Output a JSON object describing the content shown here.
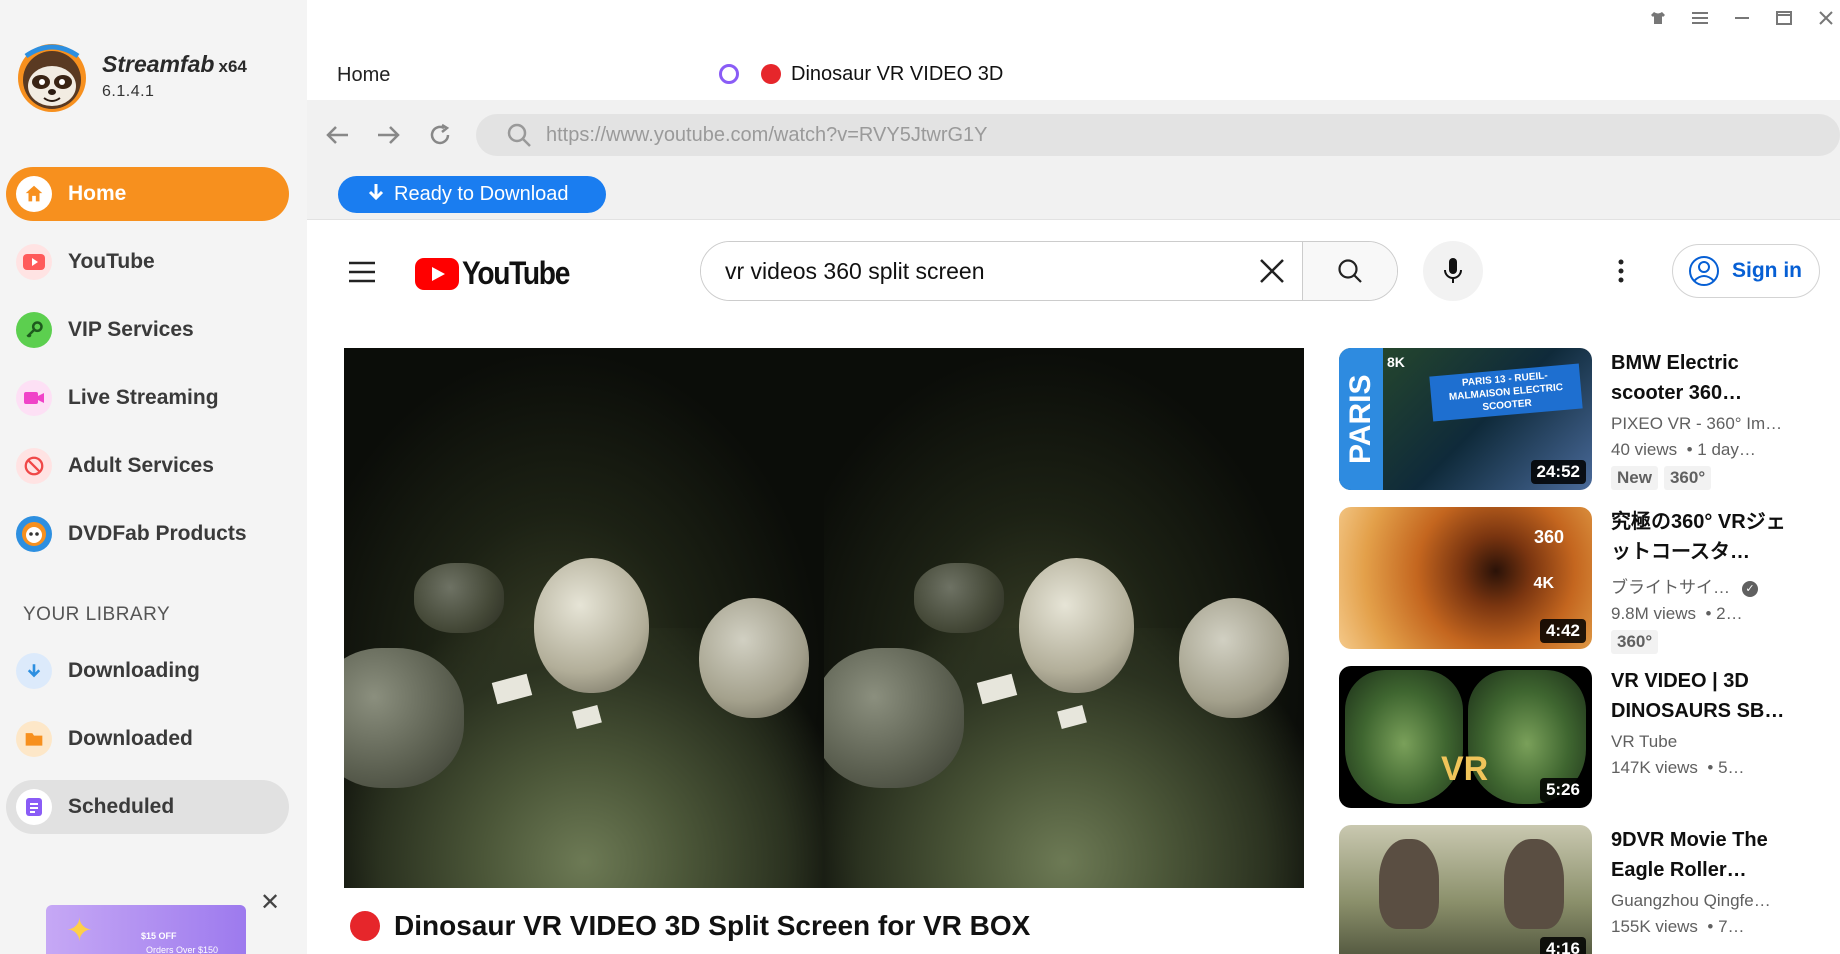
{
  "app": {
    "name": "Streamfab",
    "arch": "x64",
    "version": "6.1.4.1"
  },
  "nav": [
    {
      "label": "Home",
      "icon": "home-icon",
      "color": "#f7901e",
      "active": true
    },
    {
      "label": "YouTube",
      "icon": "youtube-icon",
      "color": "#ff5a5a"
    },
    {
      "label": "VIP Services",
      "icon": "key-icon",
      "color": "#4cc44c"
    },
    {
      "label": "Live Streaming",
      "icon": "camera-icon",
      "color": "#f043c8"
    },
    {
      "label": "Adult Services",
      "icon": "adult-icon",
      "color": "#f04848"
    },
    {
      "label": "DVDFab Products",
      "icon": "dvdfab-icon",
      "color": "#2d8fe0"
    }
  ],
  "library": {
    "title": "YOUR LIBRARY",
    "items": [
      {
        "label": "Downloading",
        "icon": "download-icon",
        "color": "#2d8fe0"
      },
      {
        "label": "Downloaded",
        "icon": "folder-icon",
        "color": "#f7901e"
      },
      {
        "label": "Scheduled",
        "icon": "schedule-icon",
        "color": "#8a5cf6",
        "selected": true
      }
    ]
  },
  "promo": {
    "line1": "$15 OFF",
    "line2": "Orders Over $150"
  },
  "tabs": {
    "home": "Home",
    "active": "Dinosaur VR VIDEO 3D"
  },
  "browser": {
    "url": "https://www.youtube.com/watch?v=RVY5JtwrG1Y",
    "download_button": "Ready to Download"
  },
  "youtube": {
    "logo_text": "YouTube",
    "search_query": "vr videos 360 split screen",
    "sign_in": "Sign in",
    "video_title": "Dinosaur VR VIDEO 3D Split Screen for VR BOX"
  },
  "related": [
    {
      "title": "BMW Electric scooter 360…",
      "channel": "PIXEO VR - 360° Im…",
      "views": "40 views",
      "age": "1 day…",
      "duration": "24:52",
      "badges": [
        "New",
        "360°"
      ],
      "thumb_text": {
        "side": "PARIS",
        "banner": "PARIS 13 - RUEIL-MALMAISON ELECTRIC SCOOTER",
        "res": "8K"
      }
    },
    {
      "title": "究極の360° VRジェットコースタ…",
      "channel": "ブライトサイ…",
      "verified": true,
      "views": "9.8M views",
      "age": "2…",
      "duration": "4:42",
      "badges": [
        "360°"
      ],
      "thumb_text": {
        "a": "360",
        "b": "4K"
      }
    },
    {
      "title": "VR VIDEO | 3D DINOSAURS SB…",
      "channel": "VR Tube",
      "views": "147K views",
      "age": "5…",
      "duration": "5:26",
      "badges": [],
      "thumb_text": {
        "vr": "VR"
      }
    },
    {
      "title": "9DVR Movie The Eagle Roller…",
      "channel": "Guangzhou Qingfe…",
      "views": "155K views",
      "age": "7…",
      "duration": "4:16",
      "badges": []
    }
  ]
}
